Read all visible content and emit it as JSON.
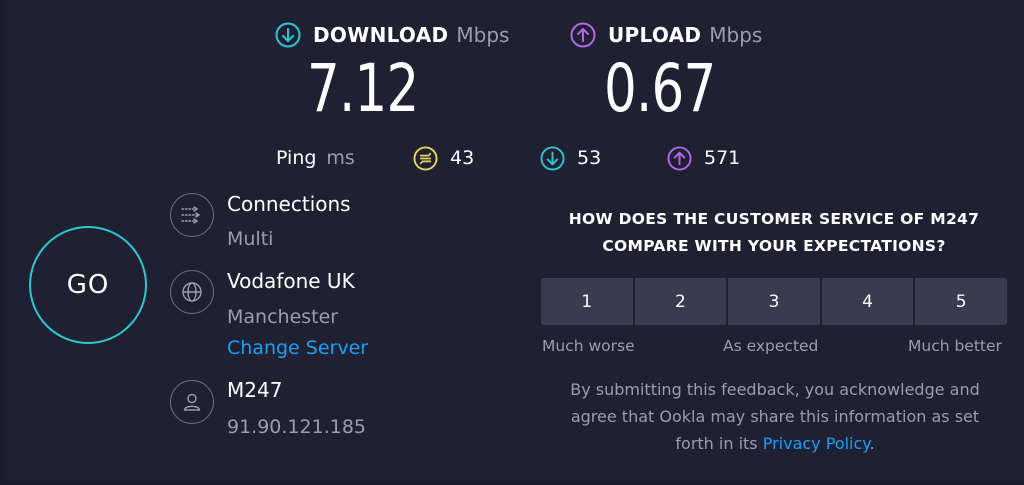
{
  "download": {
    "label": "DOWNLOAD",
    "unit": "Mbps",
    "value": "7.12",
    "icon": "download-arrow-icon",
    "color": "#2bc6cf"
  },
  "upload": {
    "label": "UPLOAD",
    "unit": "Mbps",
    "value": "0.67",
    "icon": "upload-arrow-icon",
    "color": "#b567e6"
  },
  "ping": {
    "label": "Ping",
    "unit": "ms",
    "idle": {
      "value": "43",
      "icon": "idle-latency-icon",
      "color": "#e6d45e"
    },
    "download": {
      "value": "53",
      "icon": "download-latency-icon",
      "color": "#2bc6cf"
    },
    "upload": {
      "value": "571",
      "icon": "upload-latency-icon",
      "color": "#b567e6"
    }
  },
  "go_button": {
    "label": "GO"
  },
  "connections": {
    "title": "Connections",
    "value": "Multi",
    "icon": "connections-icon"
  },
  "server": {
    "provider": "Vodafone UK",
    "location": "Manchester",
    "change_label": "Change Server",
    "icon": "globe-icon"
  },
  "user": {
    "isp": "M247",
    "ip": "91.90.121.185",
    "icon": "user-icon"
  },
  "survey": {
    "question_line1": "HOW DOES THE CUSTOMER SERVICE OF M247",
    "question_line2": "COMPARE WITH YOUR EXPECTATIONS?",
    "options": [
      "1",
      "2",
      "3",
      "4",
      "5"
    ],
    "low_label": "Much worse",
    "mid_label": "As expected",
    "high_label": "Much better"
  },
  "disclaimer": {
    "line1": "By submitting this feedback, you acknowledge and",
    "line2": "agree that Ookla may share this information as set",
    "line3_prefix": "forth in its ",
    "link": "Privacy Policy",
    "line3_suffix": "."
  },
  "colors": {
    "background": "#1f2032",
    "accent_cyan": "#2bc6cf",
    "accent_purple": "#b567e6",
    "accent_yellow": "#e6d45e",
    "link": "#1a9ff5",
    "muted_text": "#9a9cb0",
    "button_bg": "#3a3b4f"
  }
}
